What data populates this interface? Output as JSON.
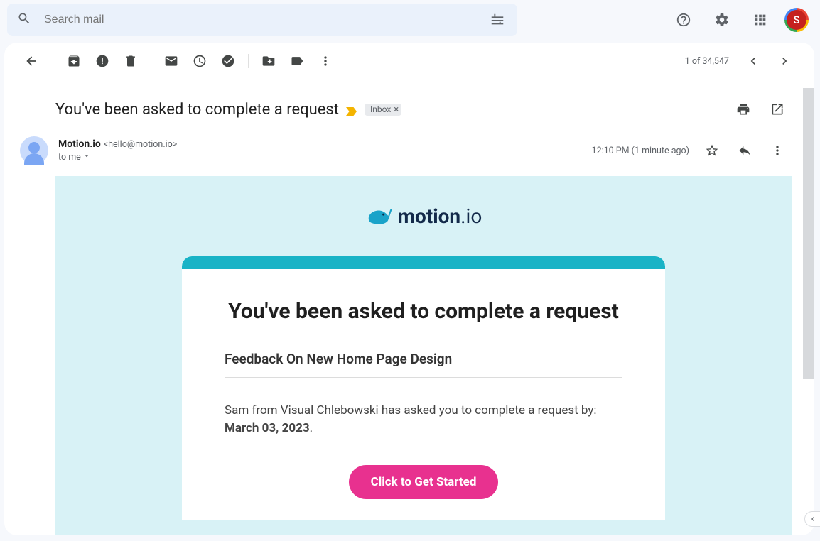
{
  "search": {
    "placeholder": "Search mail"
  },
  "header": {
    "avatar_letter": "S"
  },
  "pager": {
    "position": "1 of 34,547"
  },
  "subject": {
    "text": "You've been asked to complete a request",
    "chip_label": "Inbox"
  },
  "sender": {
    "name": "Motion.io",
    "email": "<hello@motion.io>",
    "to_line": "to me",
    "timestamp": "12:10 PM (1 minute ago)"
  },
  "email": {
    "logo_main": "motion",
    "logo_suffix": ".io",
    "headline": "You've been asked to complete a request",
    "subtitle": "Feedback On New Home Page Design",
    "body_pre": "Sam from Visual Chlebowski has asked you to complete a request by: ",
    "body_bold": "March 03, 2023",
    "body_post": ".",
    "cta": "Click to Get Started"
  }
}
